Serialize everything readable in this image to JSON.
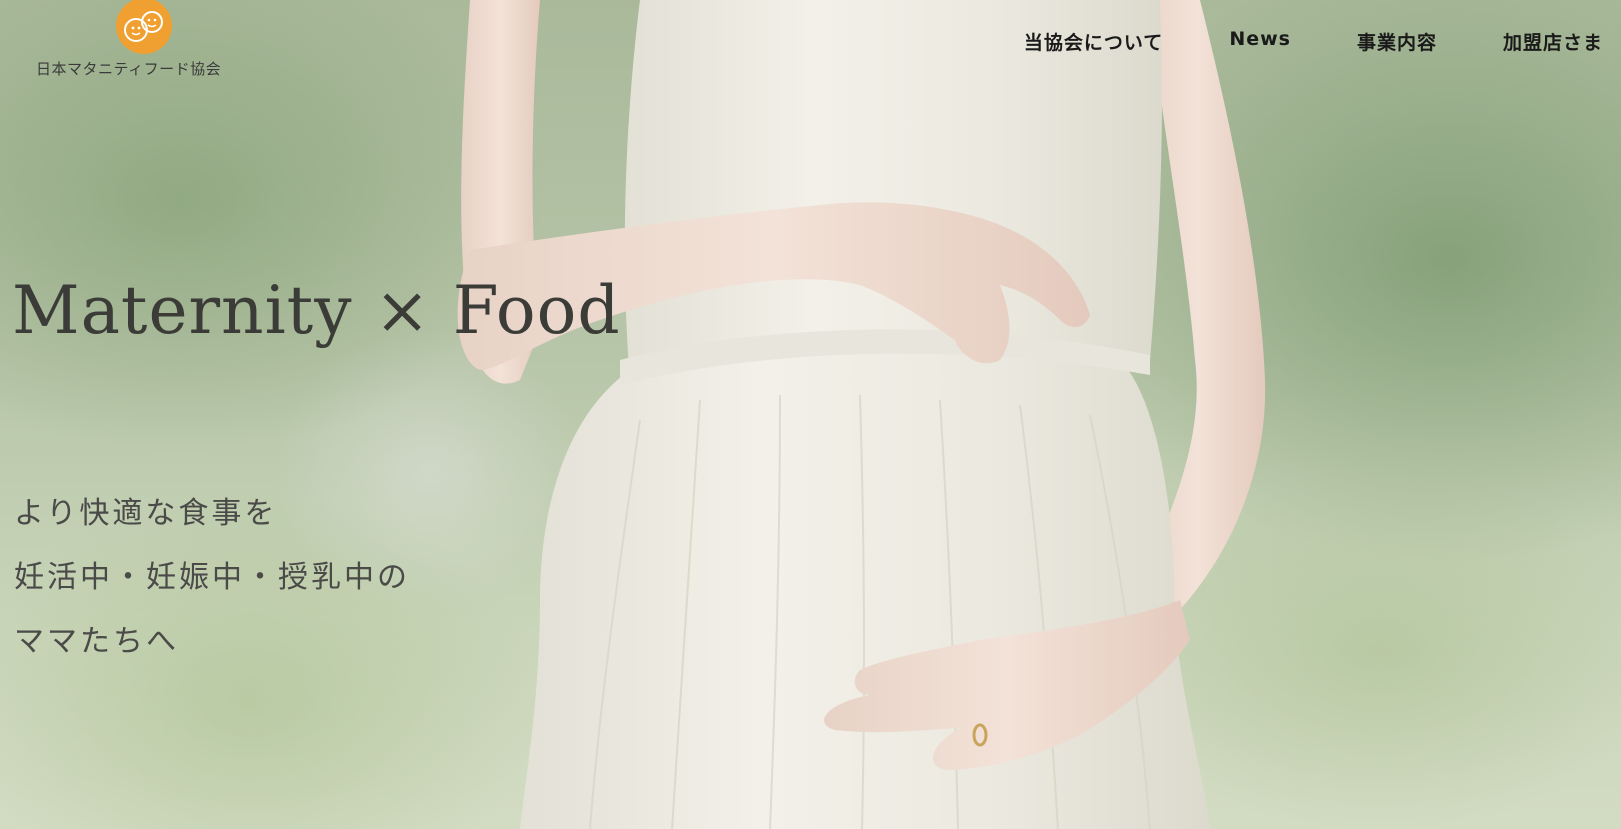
{
  "logo": {
    "org_name": "日本マタニティフード協会",
    "mark_icon": "smiling-faces-logo",
    "brand_color": "#f0a030"
  },
  "nav": {
    "items": [
      {
        "label": "当協会について"
      },
      {
        "label": "News"
      },
      {
        "label": "事業内容"
      },
      {
        "label": "加盟店さま"
      }
    ]
  },
  "hero": {
    "headline": "Maternity × Food",
    "tagline": [
      "より快適な食事を",
      "妊活中・妊娠中・授乳中の",
      "ママたちへ"
    ],
    "image_subject": "pregnant-woman-white-dress"
  }
}
